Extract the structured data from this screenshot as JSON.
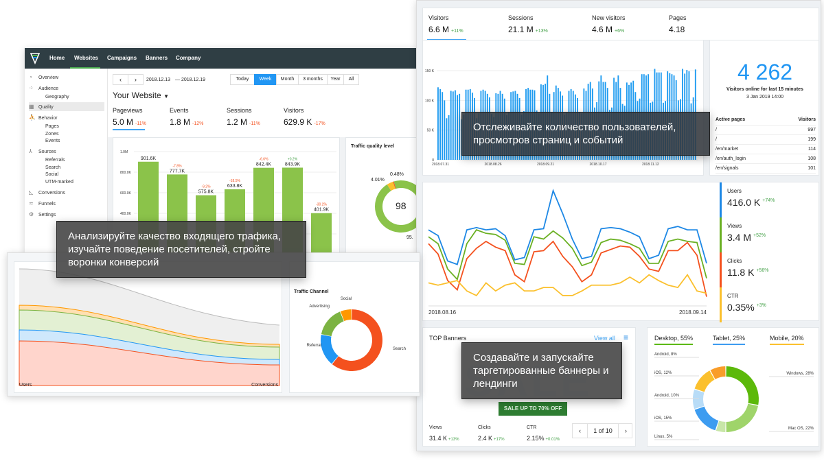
{
  "app_a": {
    "nav": [
      "Home",
      "Websites",
      "Campaigns",
      "Banners",
      "Company"
    ],
    "active_nav": "Websites",
    "sidebar": [
      {
        "label": "Overview",
        "icon": "gauge-icon",
        "sub": false
      },
      {
        "label": "Audience",
        "icon": "people-icon",
        "sub": false
      },
      {
        "label": "Geography",
        "sub": true
      },
      {
        "label": "Quality",
        "icon": "quality-icon",
        "sub": false,
        "active": true
      },
      {
        "label": "Behavior",
        "icon": "walk-icon",
        "sub": false
      },
      {
        "label": "Pages",
        "sub": true
      },
      {
        "label": "Zones",
        "sub": true
      },
      {
        "label": "Events",
        "sub": true
      },
      {
        "label": "Sources",
        "icon": "sources-icon",
        "sub": false
      },
      {
        "label": "Referrals",
        "sub": true
      },
      {
        "label": "Search",
        "sub": true
      },
      {
        "label": "Social",
        "sub": true
      },
      {
        "label": "UTM-marked",
        "sub": true
      },
      {
        "label": "Conversions",
        "icon": "conversions-icon",
        "sub": false
      },
      {
        "label": "Funnels",
        "icon": "funnel-icon",
        "sub": false
      },
      {
        "label": "Settings",
        "icon": "gear-icon",
        "sub": false
      }
    ],
    "date_from": "2018.12.13",
    "date_to": "— 2018.12.19",
    "periods": [
      "Today",
      "Week",
      "Month",
      "3 months",
      "Year",
      "All"
    ],
    "active_period": "Week",
    "site": "Your Website",
    "metrics": [
      {
        "label": "Pageviews",
        "value": "5.0 M",
        "change": "-11%"
      },
      {
        "label": "Events",
        "value": "1.8 M",
        "change": "-12%"
      },
      {
        "label": "Sessions",
        "value": "1.2 M",
        "change": "-11%"
      },
      {
        "label": "Visitors",
        "value": "629.9 K",
        "change": "-17%"
      }
    ],
    "quality_title": "Traffic quality level",
    "quality_score": "98",
    "quality_labels": [
      "4.01%",
      "0.48%",
      "95."
    ]
  },
  "tooltips": {
    "a": "Анализируйте качество входящего трафика, изучайте поведение посетителей, стройте воронки конверсий",
    "b": "Отслеживайте количество пользователей, просмотров страниц и событий",
    "c": "Создавайте и запускайте таргетированные баннеры и лендинги"
  },
  "app_b": {
    "metrics": [
      {
        "label": "Visitors",
        "value": "6.6 M",
        "change": "+11%"
      },
      {
        "label": "Sessions",
        "value": "21.1 M",
        "change": "+13%"
      },
      {
        "label": "New visitors",
        "value": "4.6 M",
        "change": "+6%"
      },
      {
        "label": "Pages",
        "value": "4.18",
        "change": ""
      }
    ],
    "online": {
      "value": "4 262",
      "label": "Visitors online for last 15 minutes",
      "date": "3 Jan 2019 14:00"
    },
    "active_pages": {
      "headers": [
        "Active pages",
        "Visitors"
      ],
      "rows": [
        [
          "/",
          "997"
        ],
        [
          "/",
          "199"
        ],
        [
          "/en/market",
          "114"
        ],
        [
          "/en/auth_login",
          "108"
        ],
        [
          "/en/signals",
          "101"
        ]
      ]
    },
    "legend": [
      {
        "label": "Users",
        "value": "416.0 K",
        "change": "+74%",
        "color": "#1e88e5"
      },
      {
        "label": "Views",
        "value": "3.4 M",
        "change": "+52%",
        "color": "#6ab023"
      },
      {
        "label": "Clicks",
        "value": "11.8 K",
        "change": "+56%",
        "color": "#f4511e"
      },
      {
        "label": "CTR",
        "value": "0.35%",
        "change": "+3%",
        "color": "#fbc02d"
      }
    ],
    "banners": {
      "title": "TOP Banners",
      "view_all": "View all",
      "banner_art": "SALE UP TO 70% OFF",
      "stats": [
        {
          "label": "Views",
          "value": "31.4 K",
          "change": "+13%"
        },
        {
          "label": "Clicks",
          "value": "2.4 K",
          "change": "+17%"
        },
        {
          "label": "CTR",
          "value": "2.15%",
          "change": "+0.01%"
        }
      ],
      "pager": "1 of 10"
    },
    "devices": {
      "tabs": [
        {
          "label": "Desktop, 55%",
          "color": "#5cb90a"
        },
        {
          "label": "Tablet, 25%",
          "color": "#3d9cf0"
        },
        {
          "label": "Mobile, 20%",
          "color": "#fbc02d"
        }
      ]
    }
  },
  "app_c": {
    "funnel_start": "Users",
    "funnel_end": "Conversions",
    "channel_title": "Traffic Channel"
  },
  "chart_data": [
    {
      "type": "bar",
      "ylim": [
        0,
        1000000
      ],
      "yticks": [
        "1.0M",
        "800.0K",
        "600.0K",
        "400.0K",
        "200.0K"
      ],
      "values": [
        901600,
        777700,
        575800,
        633800,
        842400,
        843900,
        401900
      ],
      "labels": [
        "901.6K",
        "777.7K",
        "575.8K",
        "633.8K",
        "842.4K",
        "843.9K",
        "401.9K"
      ],
      "changes": [
        "",
        "-7.8%",
        "-9.2%",
        "-18.5%",
        "-6.6%",
        "+0.2%",
        "-30.2%"
      ],
      "color": "#8bc34a"
    },
    {
      "type": "pie",
      "title": "Traffic quality level",
      "values": [
        95.51,
        4.01,
        0.48
      ],
      "colors": [
        "#8bc34a",
        "#fbc02d",
        "#f4511e"
      ]
    },
    {
      "type": "bar",
      "ylim": [
        0,
        170000
      ],
      "yticks": [
        "150 K",
        "100 K",
        "50 K",
        "0"
      ],
      "xticks": [
        "2018.07.31",
        "2018.08.26",
        "2018.09.21",
        "2018.10.17",
        "2018.11.12"
      ],
      "values": [
        122,
        119,
        114,
        100,
        70,
        75,
        116,
        115,
        117,
        109,
        111,
        68,
        76,
        118,
        118,
        119,
        113,
        104,
        70,
        78,
        116,
        118,
        116,
        111,
        105,
        77,
        72,
        112,
        111,
        116,
        111,
        103,
        75,
        80,
        114,
        115,
        116,
        111,
        104,
        76,
        82,
        119,
        121,
        118,
        118,
        117,
        83,
        78,
        127,
        126,
        128,
        142,
        111,
        80,
        114,
        125,
        121,
        115,
        108,
        76,
        79,
        116,
        119,
        116,
        110,
        104,
        80,
        78,
        120,
        116,
        128,
        131,
        120,
        88,
        97,
        132,
        142,
        131,
        131,
        121,
        84,
        88,
        138,
        131,
        142,
        121,
        94,
        91,
        130,
        126,
        130,
        133,
        114,
        99,
        103,
        144,
        144,
        142,
        144,
        96,
        98,
        153,
        147,
        147,
        147,
        96,
        99,
        149,
        146,
        144,
        142,
        134,
        100,
        102,
        153,
        145,
        151,
        149,
        95,
        105,
        152
      ]
    },
    {
      "type": "line",
      "xticks": [
        "2018.08.16",
        "2018.09.14"
      ],
      "series": [
        {
          "name": "Users",
          "color": "#1e88e5",
          "values": [
            66,
            61,
            39,
            36,
            66,
            68,
            66,
            67,
            61,
            40,
            42,
            66,
            67,
            100,
            80,
            58,
            41,
            43,
            67,
            68,
            67,
            64,
            60,
            41,
            44,
            67,
            69,
            66,
            66,
            37
          ]
        },
        {
          "name": "Views",
          "color": "#6ab023",
          "values": [
            60,
            54,
            32,
            23,
            54,
            66,
            63,
            62,
            57,
            37,
            36,
            60,
            58,
            65,
            59,
            50,
            35,
            38,
            55,
            58,
            57,
            54,
            50,
            37,
            37,
            56,
            58,
            56,
            55,
            24
          ]
        },
        {
          "name": "Clicks",
          "color": "#f4511e",
          "values": [
            54,
            45,
            22,
            14,
            41,
            50,
            56,
            51,
            48,
            27,
            21,
            47,
            48,
            56,
            43,
            34,
            21,
            27,
            46,
            49,
            52,
            51,
            43,
            32,
            30,
            48,
            48,
            55,
            44,
            8
          ]
        },
        {
          "name": "CTR",
          "color": "#fbc02d",
          "values": [
            20,
            18,
            20,
            22,
            13,
            9,
            20,
            13,
            18,
            20,
            13,
            13,
            16,
            16,
            9,
            9,
            13,
            18,
            18,
            18,
            20,
            25,
            20,
            27,
            22,
            18,
            16,
            27,
            13,
            11
          ]
        }
      ]
    },
    {
      "type": "pie",
      "labels": [
        "Windows, 28%",
        "Mac OS, 22%",
        "Linux, 5%",
        "iOS, 15%",
        "Android, 10%",
        "iOS, 12%",
        "Android, 8%"
      ],
      "values": [
        28,
        22,
        5,
        15,
        10,
        12,
        8
      ],
      "colors": [
        "#5cb90a",
        "#9fd46a",
        "#c8e6a8",
        "#3d9cf0",
        "#b8dcf7",
        "#fbc02d",
        "#f99d2a"
      ]
    },
    {
      "type": "pie",
      "title": "Traffic Channel",
      "labels": [
        "Search",
        "Referral",
        "Advertising",
        "Social"
      ],
      "values": [
        61,
        17,
        16,
        6
      ],
      "colors": [
        "#f4511e",
        "#2196f3",
        "#7cb342",
        "#ff9800"
      ]
    }
  ]
}
